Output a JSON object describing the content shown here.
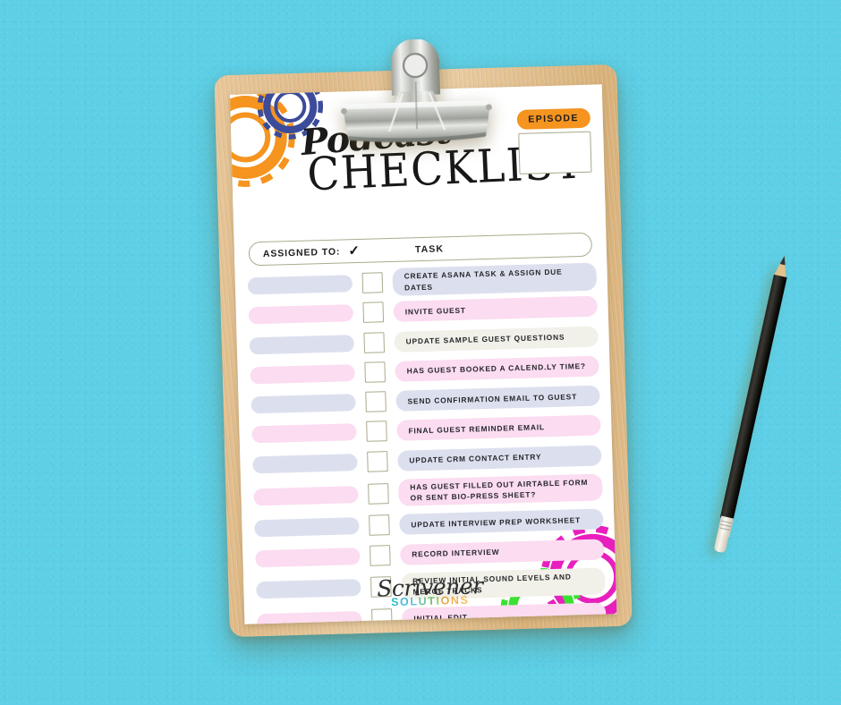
{
  "scene": {
    "background_left_color": "#5DCFE6",
    "background_right_color": "#FBD92B",
    "clipboard_wood_color": "#E2BE8E",
    "paper_color": "#FFFFFF",
    "pencil_color": "#1B1A17"
  },
  "header": {
    "title_script": "Podcast",
    "title_main": "CHECKLIST",
    "episode_label": "EPISODE",
    "episode_value": "",
    "episode_badge_color": "#F5941F"
  },
  "table_header": {
    "assigned_to": "ASSIGNED TO:",
    "check_glyph": "✓",
    "task": "TASK"
  },
  "colors": {
    "lavender": "#DCE0EE",
    "pink": "#FBDCF0",
    "cream": "#F1F1E9",
    "checkbox_border": "#A9AB8C"
  },
  "rows": [
    {
      "name_color": "lavender",
      "task_color": "lavender",
      "checked": false,
      "task": "CREATE ASANA TASK & ASSIGN DUE DATES"
    },
    {
      "name_color": "pink",
      "task_color": "pink",
      "checked": false,
      "task": "INVITE GUEST"
    },
    {
      "name_color": "lavender",
      "task_color": "cream",
      "checked": false,
      "task": "UPDATE SAMPLE GUEST QUESTIONS"
    },
    {
      "name_color": "pink",
      "task_color": "pink",
      "checked": false,
      "task": "HAS GUEST BOOKED A CALEND.LY TIME?"
    },
    {
      "name_color": "lavender",
      "task_color": "lavender",
      "checked": false,
      "task": "SEND CONFIRMATION EMAIL TO GUEST"
    },
    {
      "name_color": "pink",
      "task_color": "pink",
      "checked": false,
      "task": "FINAL GUEST REMINDER EMAIL"
    },
    {
      "name_color": "lavender",
      "task_color": "lavender",
      "checked": false,
      "task": "UPDATE CRM CONTACT ENTRY"
    },
    {
      "name_color": "pink",
      "task_color": "pink",
      "checked": false,
      "task": "HAS GUEST FILLED OUT AIRTABLE FORM OR SENT BIO-PRESS SHEET?",
      "two_line": true
    },
    {
      "name_color": "lavender",
      "task_color": "lavender",
      "checked": false,
      "task": "UPDATE INTERVIEW PREP WORKSHEET"
    },
    {
      "name_color": "pink",
      "task_color": "pink",
      "checked": false,
      "task": "RECORD INTERVIEW"
    },
    {
      "name_color": "lavender",
      "task_color": "cream",
      "checked": false,
      "task": "REVIEW INITIAL SOUND LEVELS AND MERGE TRACKS",
      "two_line": true
    },
    {
      "name_color": "pink",
      "task_color": "pink",
      "checked": false,
      "task": "INITIAL EDIT"
    }
  ],
  "logo": {
    "script": "Scrivener",
    "sub_letters": [
      {
        "ch": "S",
        "color": "#2FC0C6"
      },
      {
        "ch": "O",
        "color": "#49B7E0"
      },
      {
        "ch": "L",
        "color": "#5FBFD8"
      },
      {
        "ch": "U",
        "color": "#6FC4A0"
      },
      {
        "ch": "T",
        "color": "#6FC46E"
      },
      {
        "ch": "I",
        "color": "#8CC96A"
      },
      {
        "ch": "O",
        "color": "#E7A84A"
      },
      {
        "ch": "N",
        "color": "#F2B25A"
      },
      {
        "ch": "S",
        "color": "#F5BD66"
      }
    ]
  },
  "decor": {
    "gear_top_left_outer": "#F5941F",
    "gear_top_left_inner": "#3C4C9A",
    "gear_bottom_right_outer": "#E81FBD",
    "gear_bottom_right_inner": "#3BE033"
  }
}
